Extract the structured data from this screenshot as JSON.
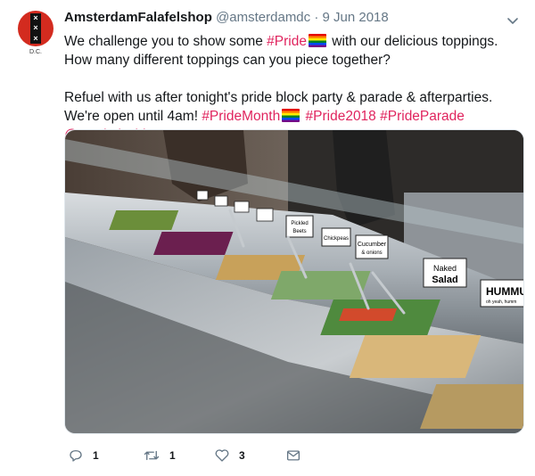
{
  "tweet": {
    "display_name": "AmsterdamFalafelshop",
    "handle": "@amsterdamdc",
    "separator": "·",
    "date": "9 Jun 2018",
    "avatar": {
      "marks": [
        "×",
        "×",
        "×"
      ],
      "caption": "D.C."
    },
    "line1_a": "We challenge you to show some ",
    "line1_tag": "#Pride",
    "line1_b": " with our delicious toppings. How many different toppings can you piece together?",
    "line2_a": "Refuel with us after tonight's pride block party & parade & afterparties. We're open until 4am! ",
    "tag_pride_month": "#PrideMonth",
    "tag_pride2018": "#Pride2018",
    "tag_pride_parade": "#PrideParade",
    "mention": "@CapitalPrideDC",
    "flag_icon": "rainbow-flag-icon"
  },
  "photo": {
    "labels": {
      "naked_salad_1": "Naked",
      "naked_salad_2": "Salad",
      "hummus": "HUMMU",
      "hummus_sub": "oh yeah, humm",
      "cucumber_1": "Cucumber",
      "cucumber_2": "& onions",
      "chickpeas": "Chickpeas",
      "pickled_1": "Pickled",
      "pickled_2": "Beets"
    }
  },
  "actions": {
    "reply": {
      "icon": "reply-icon",
      "count": "1"
    },
    "retweet": {
      "icon": "retweet-icon",
      "count": "1"
    },
    "like": {
      "icon": "heart-icon",
      "count": "3"
    },
    "dm": {
      "icon": "envelope-icon"
    }
  },
  "colors": {
    "hashtag": "#e0245e",
    "muted": "#657786",
    "text": "#14171a"
  }
}
